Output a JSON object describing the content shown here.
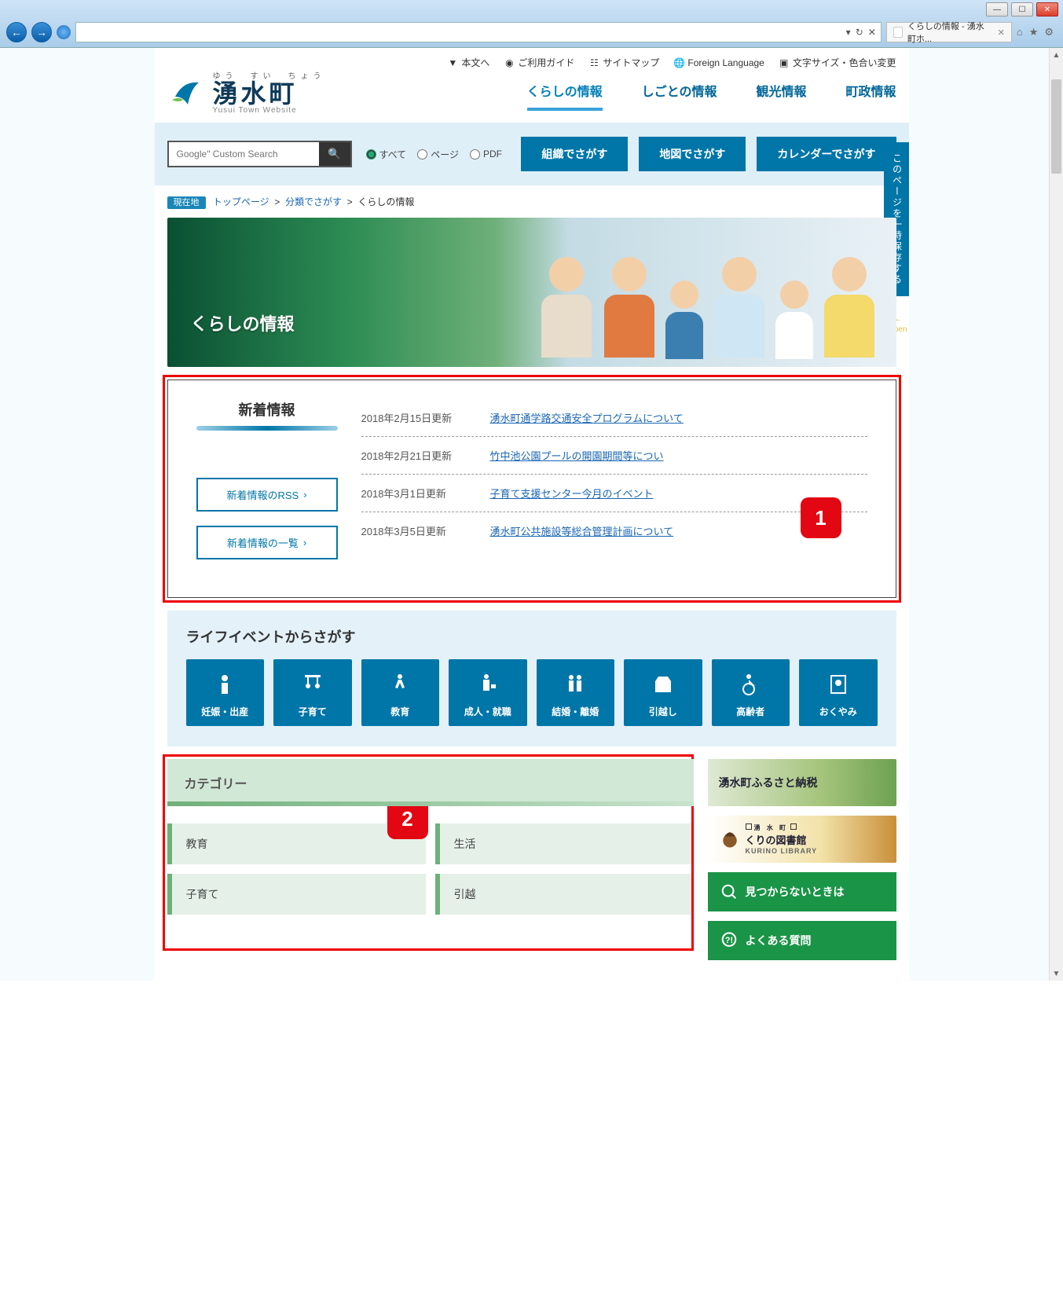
{
  "browser": {
    "tab_title": "くらしの情報 - 湧水町ホ...",
    "refresh_glyph": "↻",
    "stop_glyph": "✕",
    "dropdown_glyph": "▾"
  },
  "header": {
    "util": {
      "body": "本文へ",
      "guide": "ご利用ガイド",
      "sitemap": "サイトマップ",
      "foreign": "Foreign Language",
      "textsize": "文字サイズ・色合い変更"
    },
    "logo": {
      "ruby": "ゆう　すい　ちょう",
      "main": "湧水町",
      "sub": "Yusui Town Website"
    },
    "nav": [
      "くらしの情報",
      "しごとの情報",
      "観光情報",
      "町政情報"
    ]
  },
  "search": {
    "placeholder": "Google\" Custom Search",
    "radios": [
      "すべて",
      "ページ",
      "PDF"
    ],
    "buttons": [
      "組織でさがす",
      "地図でさがす",
      "カレンダーでさがす"
    ]
  },
  "breadcrumb": {
    "badge": "現在地",
    "links": [
      "トップページ",
      "分類でさがす"
    ],
    "current": "くらしの情報"
  },
  "hero": {
    "title": "くらしの情報"
  },
  "news": {
    "title": "新着情報",
    "rss": "新着情報のRSS",
    "list_btn": "新着情報の一覧",
    "items": [
      {
        "date": "2018年2月15日更新",
        "title": "湧水町通学路交通安全プログラムについて"
      },
      {
        "date": "2018年2月21日更新",
        "title": "竹中池公園プールの開園期間等につい"
      },
      {
        "date": "2018年3月1日更新",
        "title": "子育て支援センター今月のイベント"
      },
      {
        "date": "2018年3月5日更新",
        "title": "湧水町公共施設等総合管理計画について"
      }
    ]
  },
  "life": {
    "title": "ライフイベントからさがす",
    "items": [
      "妊娠・出産",
      "子育て",
      "教育",
      "成人・就職",
      "結婚・離婚",
      "引越し",
      "高齢者",
      "おくやみ"
    ]
  },
  "category": {
    "title": "カテゴリー",
    "items": [
      "教育",
      "生活",
      "子育て",
      "引越"
    ]
  },
  "side": {
    "furusato": "湧水町ふるさと納税",
    "library_ruby": "湧 水 町",
    "library": "くりの図書館",
    "library_sub": "KURINO LIBRARY",
    "help": "見つからないときは",
    "faq": "よくある質問"
  },
  "sticky": {
    "label": "このページを一時保存する",
    "open": "open"
  },
  "annotations": {
    "one": "1",
    "two": "2"
  }
}
